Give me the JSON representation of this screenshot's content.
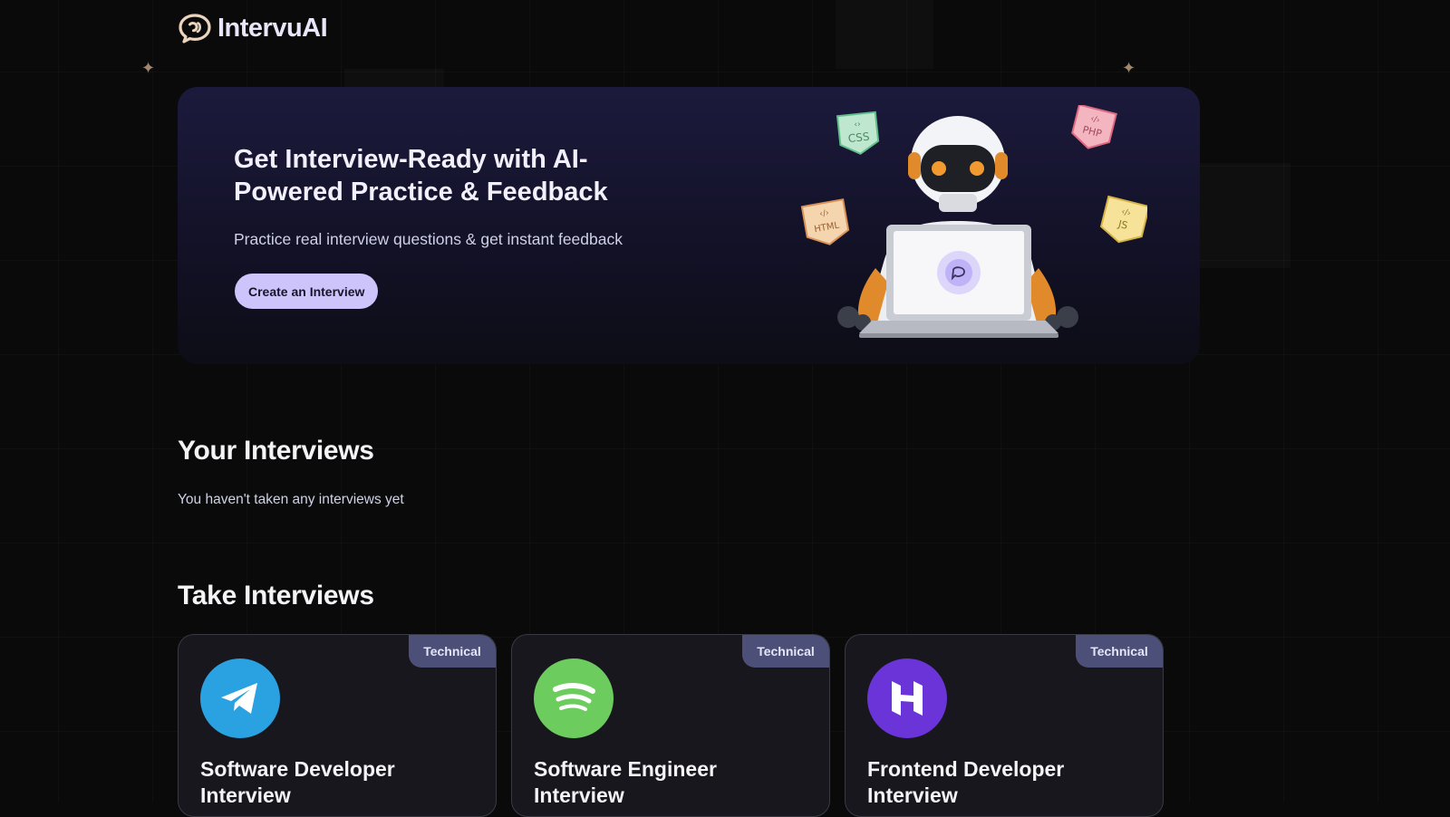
{
  "brand": {
    "name": "IntervuAI"
  },
  "hero": {
    "title": "Get Interview-Ready with AI-Powered Practice & Feedback",
    "subtitle": "Practice real interview questions & get instant feedback",
    "cta_label": "Create an Interview",
    "tags": [
      "CSS",
      "PHP",
      "HTML",
      "JS"
    ]
  },
  "your_interviews": {
    "title": "Your Interviews",
    "empty_message": "You haven't taken any interviews yet"
  },
  "take_interviews": {
    "title": "Take Interviews",
    "cards": [
      {
        "badge": "Technical",
        "title": "Software Developer Interview",
        "icon": "telegram-icon",
        "color": "#2aa1e0"
      },
      {
        "badge": "Technical",
        "title": "Software Engineer Interview",
        "icon": "spotify-icon",
        "color": "#6dcc5e"
      },
      {
        "badge": "Technical",
        "title": "Frontend Developer Interview",
        "icon": "hostinger-icon",
        "color": "#6a34d9"
      }
    ]
  },
  "colors": {
    "background": "#0a0a0b",
    "accent": "#cdc4fb",
    "badge": "#4c5079"
  }
}
